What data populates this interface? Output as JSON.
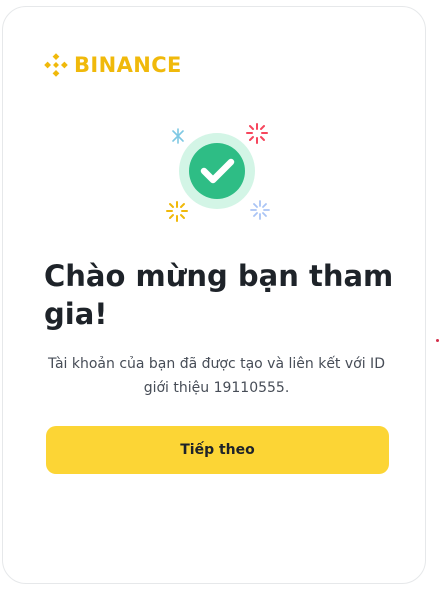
{
  "brand": {
    "name": "BINANCE",
    "logo_icon": "binance-logo-icon",
    "color": "#F0B90B"
  },
  "illustration": {
    "icon": "success-check-icon",
    "check_color": "#2EBD85",
    "halo_color": "#D3F5E6",
    "sparkle_colors": [
      "#7EC8E3",
      "#F6465D",
      "#F0B90B",
      "#A9C4F5"
    ]
  },
  "welcome": {
    "title": "Chào mừng bạn tham gia!",
    "message": "Tài khoản của bạn đã được tạo và liên kết với ID giới thiệu 19110555."
  },
  "actions": {
    "continue_label": "Tiếp theo",
    "continue_color": "#FCD535"
  }
}
